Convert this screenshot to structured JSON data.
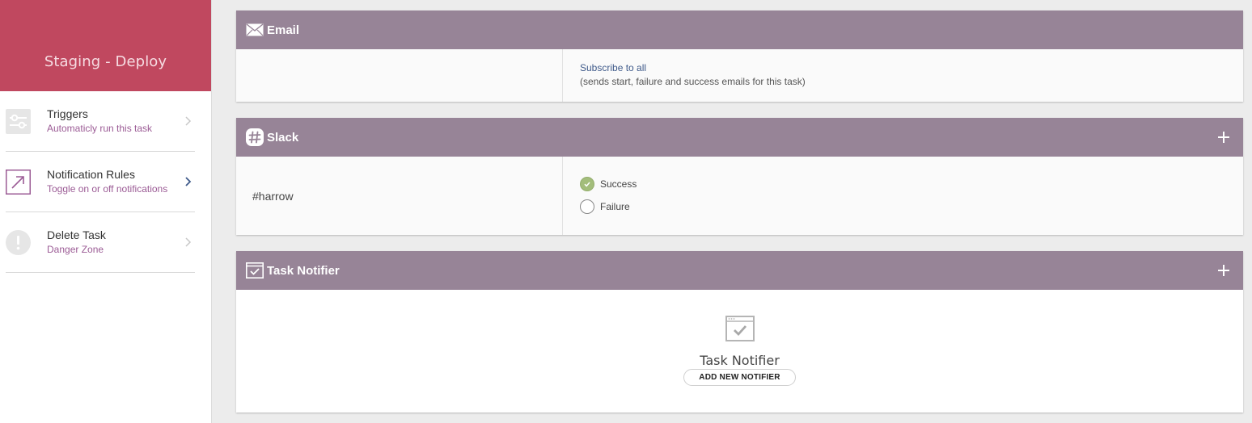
{
  "sidebar": {
    "title": "Staging - Deploy",
    "header_color": "#c0485f",
    "items": [
      {
        "label": "Triggers",
        "sublabel": "Automaticly run this task",
        "icon": "sliders-icon",
        "active": false
      },
      {
        "label": "Notification Rules",
        "sublabel": "Toggle on or off notifications",
        "icon": "arrow-up-right-icon",
        "active": true
      },
      {
        "label": "Delete Task",
        "sublabel": "Danger Zone",
        "icon": "exclamation-icon",
        "active": false
      }
    ]
  },
  "email": {
    "title": "Email",
    "icon": "envelope-icon",
    "subscribe_label": "Subscribe to all",
    "subscribe_desc": "(sends start, failure and success emails for this task)"
  },
  "slack": {
    "title": "Slack",
    "icon": "slack-hash-icon",
    "channel": "#harrow",
    "options": [
      {
        "label": "Success",
        "checked": true
      },
      {
        "label": "Failure",
        "checked": false
      }
    ]
  },
  "task_notifier": {
    "title": "Task Notifier",
    "icon": "checked-window-icon",
    "empty_title": "Task Notifier",
    "add_button": "ADD NEW NOTIFIER"
  },
  "colors": {
    "panel_header": "#978497",
    "accent_sub": "#9b5b95",
    "success": "#a3bd7b"
  }
}
